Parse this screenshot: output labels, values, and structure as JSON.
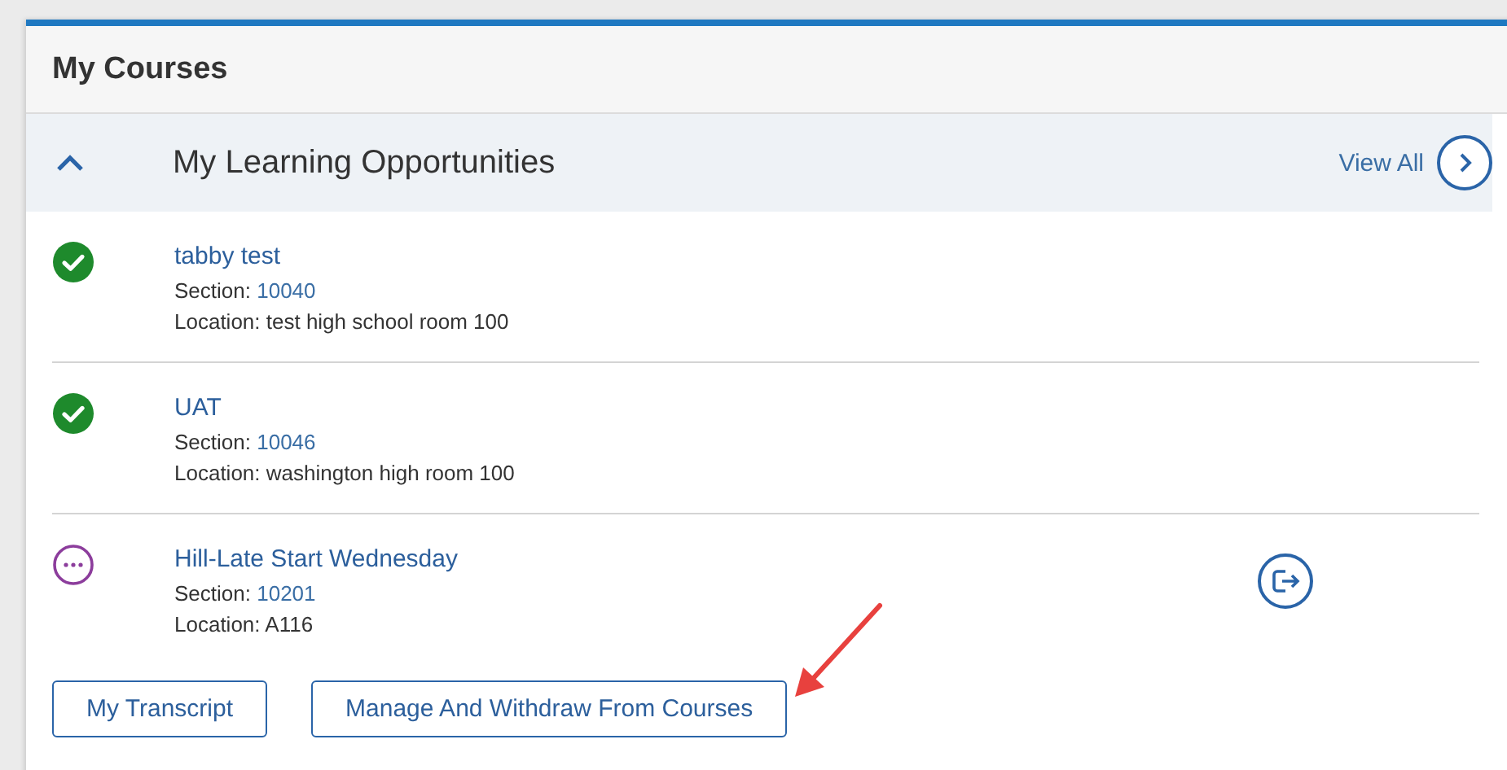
{
  "card": {
    "title": "My Courses"
  },
  "section": {
    "title": "My Learning Opportunities",
    "expanded": true,
    "view_all": "View All"
  },
  "courses": [
    {
      "name": "tabby test",
      "section_label": "Section:",
      "section": "10040",
      "location": "Location: test high school room 100",
      "kind": "completed",
      "withdrawable": false
    },
    {
      "name": "UAT",
      "section_label": "Section:",
      "section": "10046",
      "location": "Location: washington high room 100",
      "kind": "completed",
      "withdrawable": false
    },
    {
      "name": "Hill-Late Start Wednesday",
      "section_label": "Section:",
      "section": "10201",
      "location": "Location: A116",
      "kind": "pending",
      "withdrawable": true
    }
  ],
  "buttons": [
    "My Transcript",
    "Manage And Withdraw From Courses"
  ],
  "annotation": {
    "kind": "arrow"
  }
}
